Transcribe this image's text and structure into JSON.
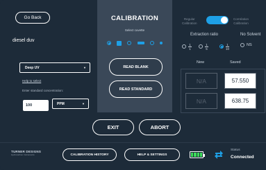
{
  "header": {
    "go_back_label": "Go Back",
    "sample_name": "diesel duv"
  },
  "calibration": {
    "title": "CALIBRATION",
    "select_cuvette_label": "Select cuvette",
    "read_blank_label": "READ BLANK",
    "read_standard_label": "READ STANDARD"
  },
  "mode": {
    "regular_label_line1": "Regular",
    "regular_label_line2": "Calibration",
    "correlation_label_line1": "Correlation",
    "correlation_label_line2": "Calibration",
    "toggle_state": "correlation"
  },
  "method": {
    "dropdown_value": "Deep UV",
    "help_link": "Help to select",
    "enter_concentration_label": "Enter standard concentration:",
    "concentration_value": "100",
    "unit_value": "PPM"
  },
  "extraction": {
    "ratio_label": "Extraction ratio",
    "no_solvent_label": "No Solvent",
    "options": [
      {
        "num": "1",
        "den": "1",
        "selected": false
      },
      {
        "num": "1",
        "den": "5",
        "selected": false
      },
      {
        "num": "1",
        "den": "10",
        "selected": true
      }
    ],
    "ns_label": "NS",
    "ns_selected": false
  },
  "results": {
    "new_header": "New",
    "saved_header": "Saved",
    "rows": [
      {
        "new": "N/A",
        "saved": "57.550"
      },
      {
        "new": "N/A",
        "saved": "638.75"
      }
    ]
  },
  "actions": {
    "exit_label": "EXIT",
    "abort_label": "ABORT"
  },
  "footer": {
    "logo_line1": "TURNER DESIGNS",
    "logo_line2": "Hydrocarbon Instruments",
    "calibration_history_label": "CALIBRATION HISTORY",
    "help_settings_label": "HELP & SETTINGS",
    "status_label": "Status",
    "status_value": "Connected"
  },
  "colors": {
    "background": "#1d2b39",
    "panel": "#3a4858",
    "accent": "#1ea0e6",
    "battery": "#3ddc5a"
  }
}
